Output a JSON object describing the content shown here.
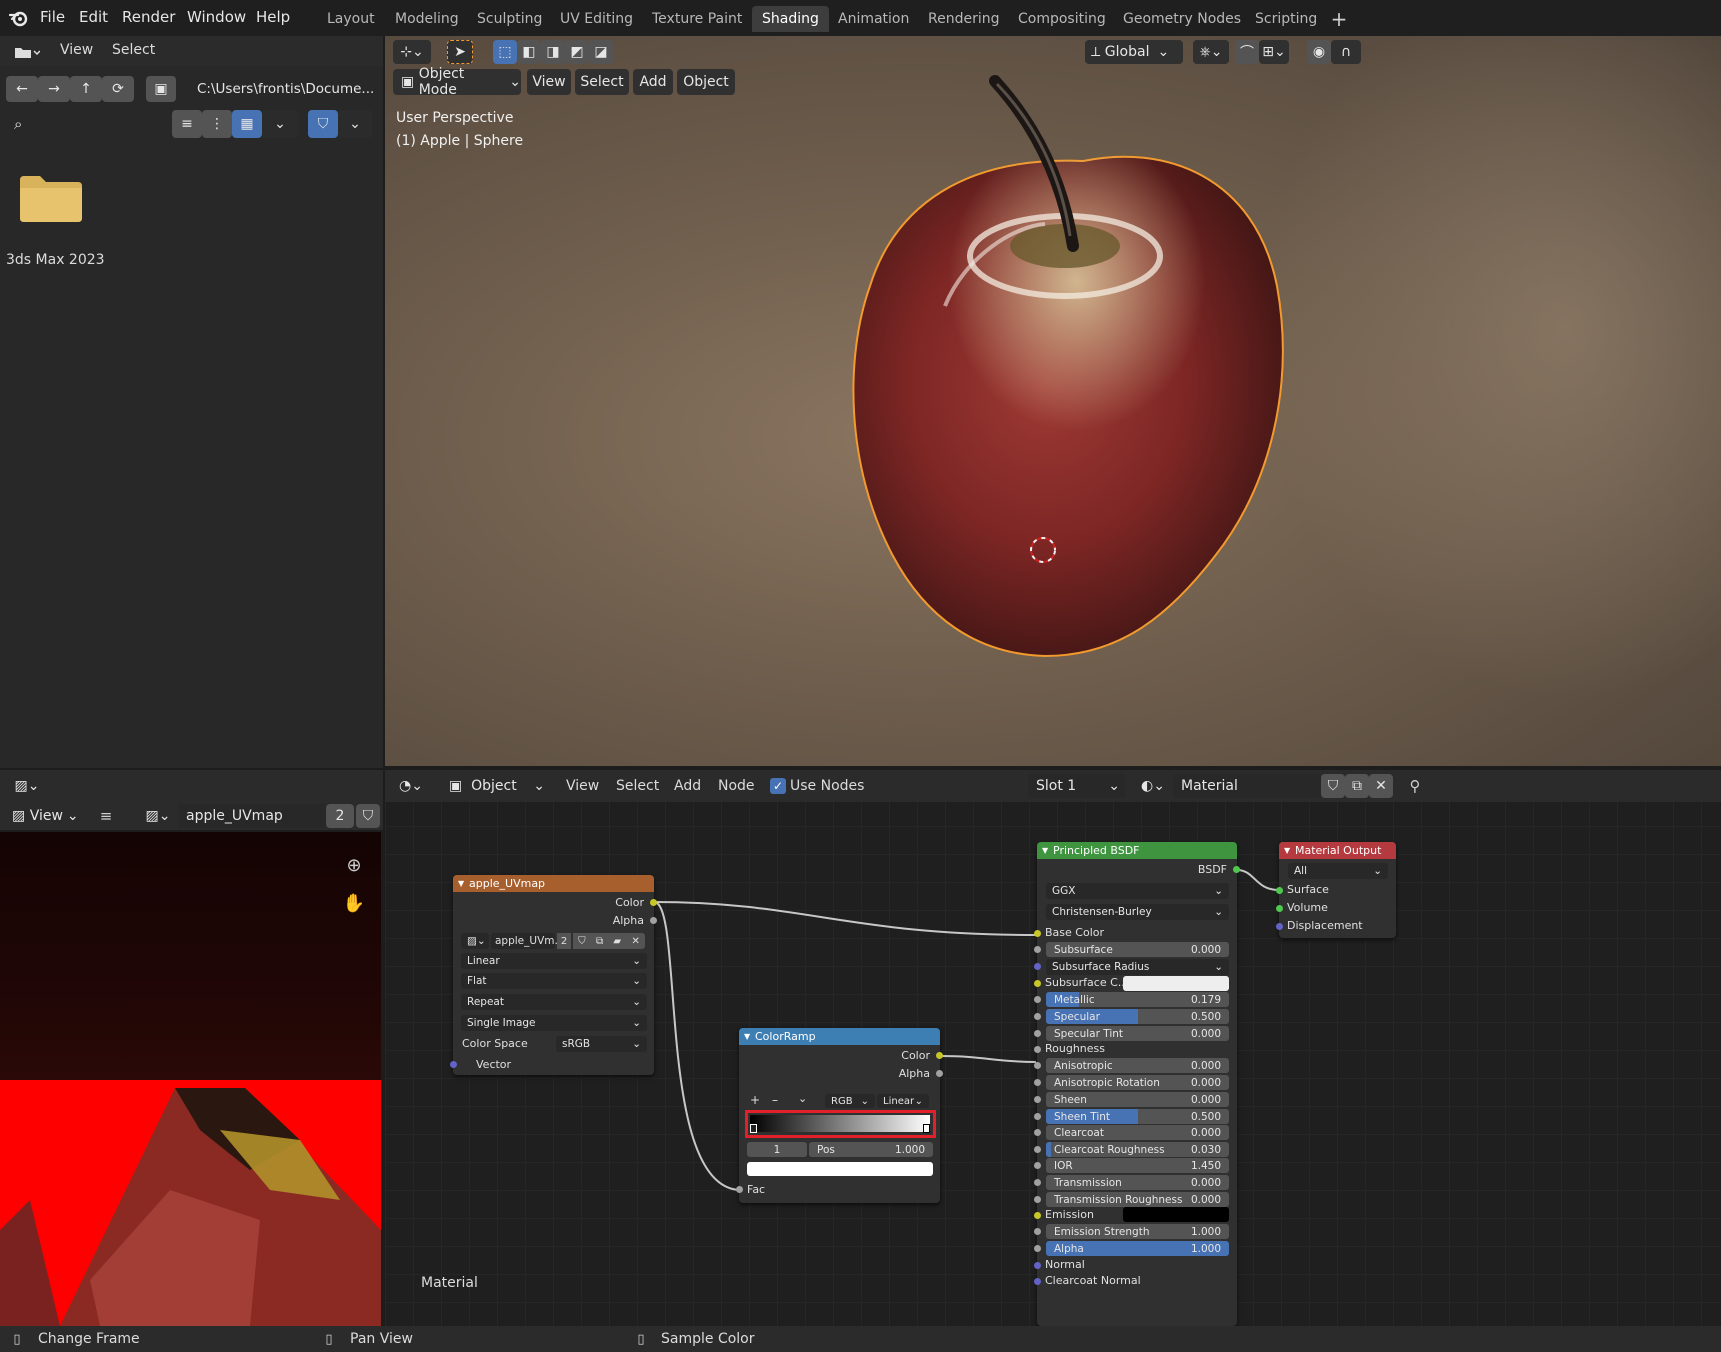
{
  "app": {
    "logo_icon": "blender-logo-icon"
  },
  "menu": [
    "File",
    "Edit",
    "Render",
    "Window",
    "Help"
  ],
  "workspaces": [
    {
      "label": "Layout",
      "active": false
    },
    {
      "label": "Modeling",
      "active": false
    },
    {
      "label": "Sculpting",
      "active": false
    },
    {
      "label": "UV Editing",
      "active": false
    },
    {
      "label": "Texture Paint",
      "active": false
    },
    {
      "label": "Shading",
      "active": true
    },
    {
      "label": "Animation",
      "active": false
    },
    {
      "label": "Rendering",
      "active": false
    },
    {
      "label": "Compositing",
      "active": false
    },
    {
      "label": "Geometry Nodes",
      "active": false
    },
    {
      "label": "Scripting",
      "active": false
    }
  ],
  "file_browser": {
    "menu": [
      "View",
      "Select"
    ],
    "path": "C:\\Users\\frontis\\Docume...",
    "search_placeholder": "",
    "folder_label": "3ds Max 2023"
  },
  "viewport": {
    "transform_orientation": "Global",
    "mode": "Object Mode",
    "menu": [
      "View",
      "Select",
      "Add",
      "Object"
    ],
    "overlay_line1": "User Perspective",
    "overlay_line2": "(1) Apple | Sphere"
  },
  "image_editor": {
    "view_label": "View",
    "image_name": "apple_UVmap",
    "users": "2"
  },
  "node_editor": {
    "type": "Object",
    "menu": [
      "View",
      "Select",
      "Add",
      "Node"
    ],
    "use_nodes_label": "Use Nodes",
    "use_nodes_checked": true,
    "slot": "Slot 1",
    "material": "Material",
    "footer_label": "Material",
    "image_node": {
      "title": "apple_UVmap",
      "out_color": "Color",
      "out_alpha": "Alpha",
      "image": "apple_UVm...",
      "users": "2",
      "interpolation": "Linear",
      "projection": "Flat",
      "extension": "Repeat",
      "source": "Single Image",
      "color_space_label": "Color Space",
      "color_space": "sRGB",
      "in_vector": "Vector"
    },
    "colorramp_node": {
      "title": "ColorRamp",
      "out_color": "Color",
      "out_alpha": "Alpha",
      "color_mode": "RGB",
      "interpolation": "Linear",
      "plus": "+",
      "minus": "–",
      "stop_index": "1",
      "pos_label": "Pos",
      "pos_value": "1.000",
      "in_fac": "Fac"
    },
    "bsdf_node": {
      "title": "Principled BSDF",
      "out_bsdf": "BSDF",
      "distribution": "GGX",
      "subsurface_method": "Christensen-Burley",
      "base_color": "Base Color",
      "subsurface_radius": "Subsurface Radius",
      "subsurface_color": "Subsurface C...",
      "roughness": "Roughness",
      "emission": "Emission",
      "normal": "Normal",
      "clearcoat_normal": "Clearcoat Normal",
      "fields": [
        {
          "label": "Subsurface",
          "value": "0.000",
          "fill": 0
        },
        {
          "label": "Metallic",
          "value": "0.179",
          "fill": 0.179
        },
        {
          "label": "Specular",
          "value": "0.500",
          "fill": 0.5
        },
        {
          "label": "Specular Tint",
          "value": "0.000",
          "fill": 0
        },
        {
          "label": "Anisotropic",
          "value": "0.000",
          "fill": 0
        },
        {
          "label": "Anisotropic Rotation",
          "value": "0.000",
          "fill": 0
        },
        {
          "label": "Sheen",
          "value": "0.000",
          "fill": 0
        },
        {
          "label": "Sheen Tint",
          "value": "0.500",
          "fill": 0.5
        },
        {
          "label": "Clearcoat",
          "value": "0.000",
          "fill": 0
        },
        {
          "label": "Clearcoat Roughness",
          "value": "0.030",
          "fill": 0.03
        },
        {
          "label": "IOR",
          "value": "1.450",
          "fill": 0
        },
        {
          "label": "Transmission",
          "value": "0.000",
          "fill": 0
        },
        {
          "label": "Transmission Roughness",
          "value": "0.000",
          "fill": 0
        },
        {
          "label": "Emission Strength",
          "value": "1.000",
          "fill": 0
        },
        {
          "label": "Alpha",
          "value": "1.000",
          "fill": 1
        }
      ]
    },
    "output_node": {
      "title": "Material Output",
      "target": "All",
      "in_surface": "Surface",
      "in_volume": "Volume",
      "in_displacement": "Displacement"
    }
  },
  "status_bar": {
    "items": [
      "Change Frame",
      "Pan View",
      "Sample Color"
    ]
  },
  "colors": {
    "accent": "#4772b3",
    "highlight_box": "#e0202a",
    "selection_outline": "#f29a2e",
    "image_node_header": "#a85f2e",
    "colorramp_header": "#3e7fb3",
    "bsdf_header": "#3f9440",
    "output_header": "#b53a3f"
  }
}
